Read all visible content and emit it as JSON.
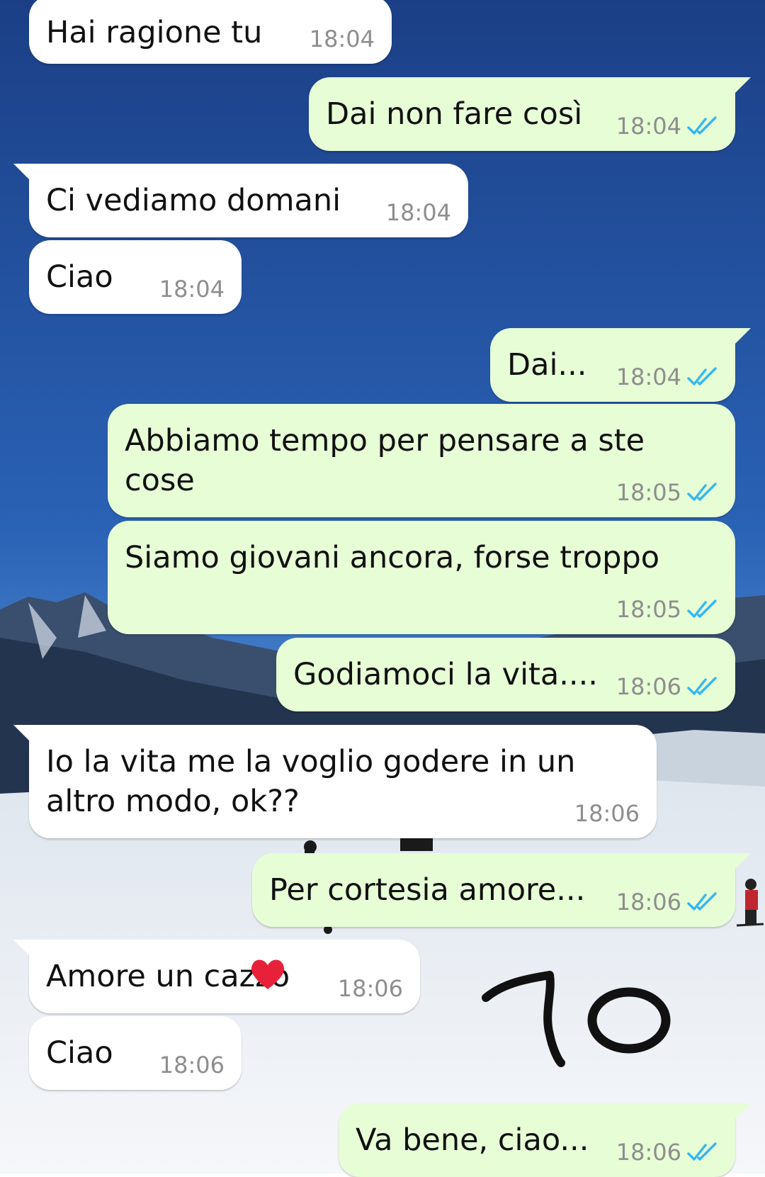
{
  "messages": [
    {
      "id": "m1",
      "direction": "in",
      "text": "Hai ragione tu",
      "time": "18:04"
    },
    {
      "id": "m2",
      "direction": "out",
      "text": "Dai non fare così",
      "time": "18:04",
      "status": "read"
    },
    {
      "id": "m3",
      "direction": "in",
      "text": "Ci vediamo domani",
      "time": "18:04"
    },
    {
      "id": "m4",
      "direction": "in",
      "text": "Ciao",
      "time": "18:04"
    },
    {
      "id": "m5",
      "direction": "out",
      "text": "Dai...",
      "time": "18:04",
      "status": "read"
    },
    {
      "id": "m6",
      "direction": "out",
      "text_lines": [
        "Abbiamo tempo per pensare a ste",
        "cose"
      ],
      "time": "18:05",
      "status": "read"
    },
    {
      "id": "m7",
      "direction": "out",
      "text": "Siamo giovani ancora, forse troppo",
      "time": "18:05",
      "status": "read"
    },
    {
      "id": "m8",
      "direction": "out",
      "text": "Godiamoci la vita....",
      "time": "18:06",
      "status": "read"
    },
    {
      "id": "m9",
      "direction": "in",
      "text_lines": [
        "Io la vita me la voglio godere in un",
        "altro modo, ok??"
      ],
      "time": "18:06"
    },
    {
      "id": "m10",
      "direction": "out",
      "text": "Per cortesia amore...",
      "time": "18:06",
      "status": "read"
    },
    {
      "id": "m11",
      "direction": "in",
      "text": "Amore un cazzo",
      "time": "18:06",
      "note": "partially covered by red heart sticker"
    },
    {
      "id": "m12",
      "direction": "in",
      "text": "Ciao",
      "time": "18:06"
    },
    {
      "id": "m13",
      "direction": "out",
      "text": "Va bene, ciao...",
      "time": "18:06",
      "status": "read"
    }
  ],
  "overlays": {
    "heart_sticker": {
      "icon": "red-heart-sticker",
      "color": "#e8213a"
    },
    "handwritten_number": {
      "icon": "handwritten-70",
      "color": "#111111"
    }
  },
  "colors": {
    "incoming_bubble": "#ffffff",
    "outgoing_bubble": "#e7fdd6",
    "timestamp": "#8e8e8e",
    "read_ticks": "#34b7f1",
    "sky": "#1f4f98",
    "snow": "#eef2f6"
  }
}
